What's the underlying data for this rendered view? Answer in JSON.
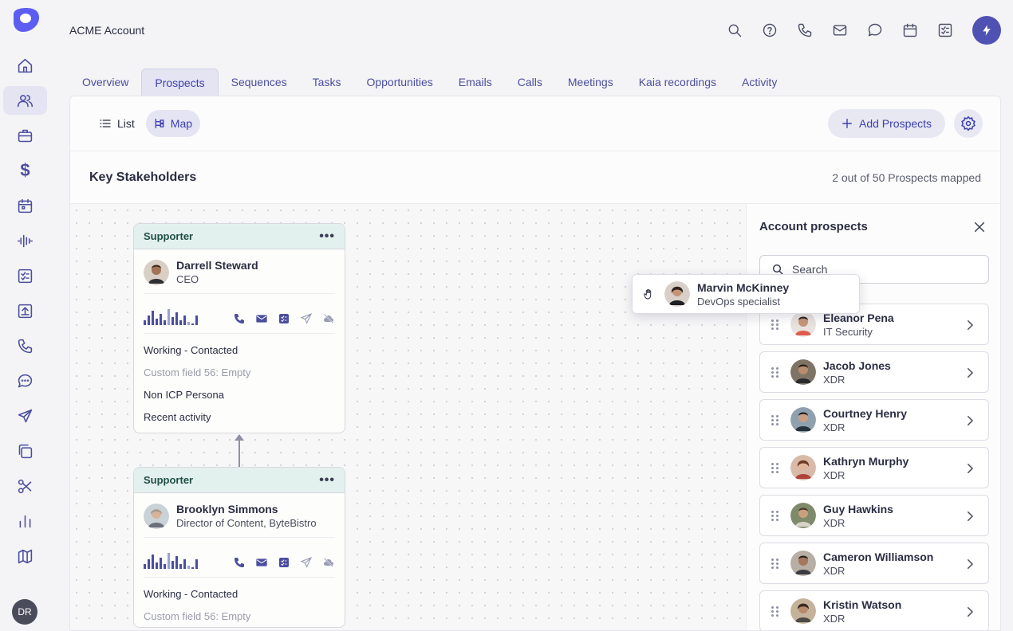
{
  "app": {
    "account_name": "ACME Account",
    "user_initials": "DR"
  },
  "tabs": [
    {
      "label": "Overview"
    },
    {
      "label": "Prospects"
    },
    {
      "label": "Sequences"
    },
    {
      "label": "Tasks"
    },
    {
      "label": "Opportunities"
    },
    {
      "label": "Emails"
    },
    {
      "label": "Calls"
    },
    {
      "label": "Meetings"
    },
    {
      "label": "Kaia recordings"
    },
    {
      "label": "Activity"
    }
  ],
  "toolbar": {
    "list_label": "List",
    "map_label": "Map",
    "add_label": "Add Prospects"
  },
  "stakeholders": {
    "title": "Key Stakeholders",
    "mapped_count": "2 out of 50 Prospects mapped"
  },
  "map_cards": [
    {
      "role": "Supporter",
      "name": "Darrell Steward",
      "title": "CEO",
      "status": "Working - Contacted",
      "custom_field": "Custom field 56: Empty",
      "persona": "Non ICP Persona",
      "recent": "Recent activity"
    },
    {
      "role": "Supporter",
      "name": "Brooklyn Simmons",
      "title": "Director of Content, ByteBistro",
      "status": "Working - Contacted",
      "custom_field": "Custom field 56: Empty"
    }
  ],
  "dragging": {
    "name": "Marvin McKinney",
    "title": "DevOps specialist"
  },
  "account_prospects": {
    "title": "Account prospects",
    "search_placeholder": "Search",
    "items": [
      {
        "name": "Eleanor Pena",
        "title": "IT Security"
      },
      {
        "name": "Jacob Jones",
        "title": "XDR"
      },
      {
        "name": "Courtney Henry",
        "title": "XDR"
      },
      {
        "name": "Kathryn Murphy",
        "title": "XDR"
      },
      {
        "name": "Guy Hawkins",
        "title": "XDR"
      },
      {
        "name": "Cameron Williamson",
        "title": "XDR"
      },
      {
        "name": "Kristin Watson",
        "title": "XDR"
      }
    ]
  },
  "colors": {
    "accent": "#4f52b2",
    "role_header": "#e3f1ee",
    "role_text": "#1f4f44"
  }
}
